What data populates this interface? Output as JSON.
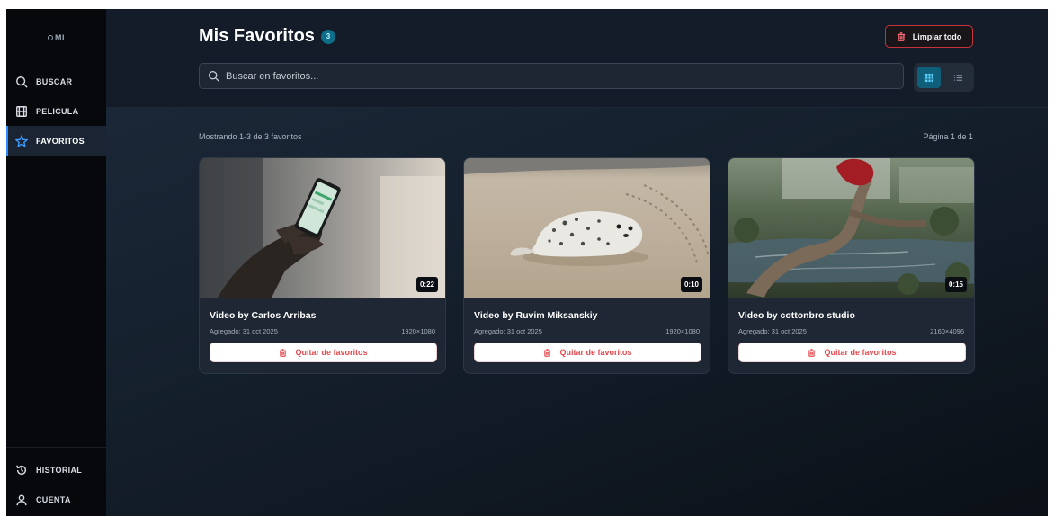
{
  "app": {
    "logo": "MI"
  },
  "sidebar": {
    "items": [
      {
        "label": "BUSCAR",
        "icon": "search-icon"
      },
      {
        "label": "PELICULA",
        "icon": "film-icon"
      },
      {
        "label": "FAVORITOS",
        "icon": "star-icon",
        "active": true
      }
    ],
    "bottom_items": [
      {
        "label": "HISTORIAL",
        "icon": "history-icon"
      },
      {
        "label": "CUENTA",
        "icon": "user-icon"
      }
    ]
  },
  "header": {
    "title": "Mis Favoritos",
    "count": "3",
    "clear_label": "Limpiar todo",
    "search_placeholder": "Buscar en favoritos..."
  },
  "results": {
    "summary": "Mostrando 1-3 de 3 favoritos",
    "page": "Página 1 de 1"
  },
  "cards": [
    {
      "title": "Video by Carlos Arribas",
      "added": "Agregado: 31 oct 2025",
      "resolution": "1920×1080",
      "duration": "0:22",
      "remove_label": "Quitar de favoritos"
    },
    {
      "title": "Video by Ruvim Miksanskiy",
      "added": "Agregado: 31 oct 2025",
      "resolution": "1920×1080",
      "duration": "0:10",
      "remove_label": "Quitar de favoritos"
    },
    {
      "title": "Video by cottonbro studio",
      "added": "Agregado: 31 oct 2025",
      "resolution": "2160×4096",
      "duration": "0:15",
      "remove_label": "Quitar de favoritos"
    }
  ],
  "colors": {
    "accent": "#2b8cff",
    "danger": "#e5484d",
    "badge": "#0e6e8a"
  }
}
